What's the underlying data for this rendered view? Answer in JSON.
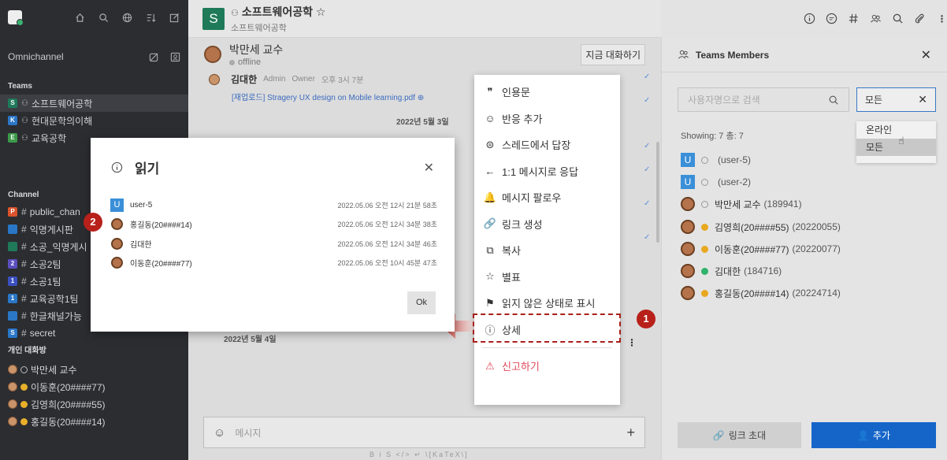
{
  "sidebar": {
    "workspace": "Omnichannel",
    "teams_header": "Teams",
    "teams": [
      {
        "badge": "S",
        "color": "#1f7a5a",
        "label": "소프트웨어공학",
        "active": true
      },
      {
        "badge": "K",
        "color": "#2a76c7",
        "label": "현대문학의이해",
        "active": false
      },
      {
        "badge": "E",
        "color": "#3c9a4a",
        "label": "교육공학",
        "active": false
      }
    ],
    "channel_header": "Channel",
    "channels": [
      {
        "badge": "P",
        "color": "#d9532c",
        "label": "public_chan"
      },
      {
        "badge": "",
        "color": "#2a76c7",
        "label": "익명게시판"
      },
      {
        "badge": "",
        "color": "#1f7a5a",
        "label": "소공_익명게시"
      },
      {
        "badge": "2",
        "color": "#5a4fbf",
        "label": "소공2팀"
      },
      {
        "badge": "1",
        "color": "#3a4fbf",
        "label": "소공1팀"
      },
      {
        "badge": "1",
        "color": "#2a76c7",
        "label": "교육공학1팀"
      },
      {
        "badge": "",
        "color": "#2a76c7",
        "label": "한글채널가능"
      },
      {
        "badge": "S",
        "color": "#2a76c7",
        "label": "secret"
      }
    ],
    "dm_header": "개인 대화방",
    "dms": [
      {
        "label": "박만세 교수",
        "status": "offline"
      },
      {
        "label": "이동훈(20####77)",
        "status": "away"
      },
      {
        "label": "김영희(20####55)",
        "status": "away"
      },
      {
        "label": "홍길동(20####14)",
        "status": "away"
      }
    ]
  },
  "header": {
    "logo": "S",
    "title": "소프트웨어공학",
    "subtitle": "소프트웨어공학"
  },
  "dm": {
    "name": "박만세 교수",
    "status": "offline",
    "talk_button": "지금 대화하기"
  },
  "message": {
    "author": "김대한",
    "role": "Admin",
    "owner": "Owner",
    "time": "오후 3시 7분",
    "file": "[재업로드] Stragery UX design on Mobile learning.pdf",
    "date_sep_1": "2022년 5월 3일",
    "date_sep_2": "2022년 5월 4일"
  },
  "composer": {
    "placeholder": "메시지",
    "toolbar": "B  i  S  </>  ↵  \\[KaTeX\\]"
  },
  "context_menu": {
    "items": [
      {
        "icon": "quote-icon",
        "glyph": "❞",
        "label": "인용문"
      },
      {
        "icon": "add-reaction-icon",
        "glyph": "☺",
        "label": "반응 추가"
      },
      {
        "icon": "thread-icon",
        "glyph": "⊜",
        "label": "스레드에서 답장"
      },
      {
        "icon": "reply-icon",
        "glyph": "←",
        "label": "1:1 메시지로 응답"
      },
      {
        "icon": "bell-icon",
        "glyph": "🔔",
        "label": "메시지 팔로우"
      },
      {
        "icon": "link-icon",
        "glyph": "🔗",
        "label": "링크 생성"
      },
      {
        "icon": "copy-icon",
        "glyph": "⧉",
        "label": "복사"
      },
      {
        "icon": "star-icon",
        "glyph": "☆",
        "label": "별표"
      },
      {
        "icon": "flag-icon",
        "glyph": "⚑",
        "label": "읽지 않은 상태로 표시"
      },
      {
        "icon": "info-icon",
        "glyph": "ⓘ",
        "label": "상세"
      }
    ],
    "report": "신고하기"
  },
  "steps": {
    "one": "1",
    "two": "2"
  },
  "modal": {
    "title": "읽기",
    "ok": "Ok",
    "readers": [
      {
        "type": "user",
        "badge": "U",
        "name": "user-5",
        "time": "2022.05.06 오전 12시 21분 58초"
      },
      {
        "type": "photo",
        "name": "홍길동(20####14)",
        "time": "2022.05.06 오전 12시 34분 38초"
      },
      {
        "type": "photo",
        "name": "김대한",
        "time": "2022.05.06 오전 12시 34분 46초"
      },
      {
        "type": "photo",
        "name": "이동훈(20####77)",
        "time": "2022.05.06 오전 10시 45분 47초"
      }
    ]
  },
  "panel": {
    "title": "Teams Members",
    "search_placeholder": "사용자명으로 검색",
    "filter_value": "모든",
    "dropdown": [
      "온라인",
      "모든"
    ],
    "showing": "Showing: 7  총: 7",
    "members": [
      {
        "type": "user",
        "badge": "U",
        "status": "offline",
        "name": "",
        "id": "(user-5)"
      },
      {
        "type": "user",
        "badge": "U",
        "status": "offline",
        "name": "",
        "id": "(user-2)"
      },
      {
        "type": "photo",
        "status": "offline",
        "name": "박만세 교수",
        "id": "(189941)"
      },
      {
        "type": "photo",
        "status": "away",
        "name": "김영희(20####55)",
        "id": "(20220055)"
      },
      {
        "type": "photo",
        "status": "away",
        "name": "이동훈(20####77)",
        "id": "(20220077)"
      },
      {
        "type": "photo",
        "status": "online",
        "name": "김대한",
        "id": "(184716)"
      },
      {
        "type": "photo",
        "status": "away",
        "name": "홍길동(20####14)",
        "id": "(20224714)"
      }
    ],
    "invite_button": "링크 초대",
    "add_button": "추가"
  },
  "colors": {
    "accent": "#1565c9",
    "danger": "#b8201a",
    "sidebar": "#2b2d31"
  }
}
